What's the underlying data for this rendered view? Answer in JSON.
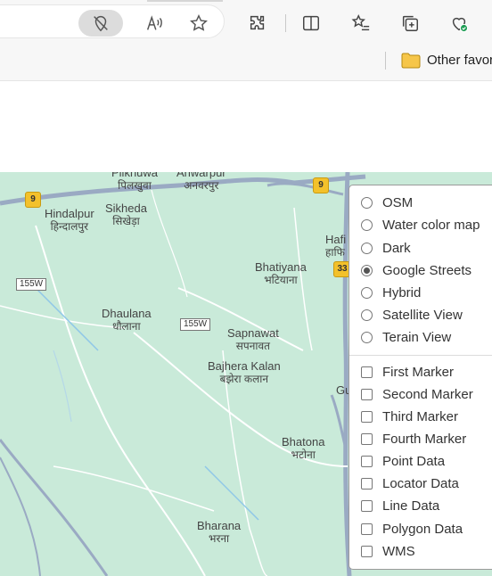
{
  "favorites": {
    "other_label": "Other favor"
  },
  "map": {
    "places": [
      {
        "name": "Pilkhuwa",
        "hindi": "पिलखुवा"
      },
      {
        "name": "Anwarpur",
        "hindi": "अनवरपुर"
      },
      {
        "name": "Hindalpur",
        "hindi": "हिन्दालपुर"
      },
      {
        "name": "Sikheda",
        "hindi": "सिखेड़ा"
      },
      {
        "name": "Hafi",
        "hindi": "हाफि"
      },
      {
        "name": "Bhatiyana",
        "hindi": "भटियाना"
      },
      {
        "name": "Dhaulana",
        "hindi": "धौलाना"
      },
      {
        "name": "Sapnawat",
        "hindi": "सपनावत"
      },
      {
        "name": "Bajhera Kalan",
        "hindi": "बझेरा कलान"
      },
      {
        "name": "Gu",
        "hindi": ""
      },
      {
        "name": "Bhatona",
        "hindi": "भटोना"
      },
      {
        "name": "Bharana",
        "hindi": "भरना"
      }
    ],
    "shields": [
      "9",
      "9",
      "33"
    ],
    "road_labels": [
      "155W",
      "155W"
    ]
  },
  "layer_control": {
    "base_layers": [
      {
        "label": "OSM",
        "selected": false
      },
      {
        "label": "Water color map",
        "selected": false
      },
      {
        "label": "Dark",
        "selected": false
      },
      {
        "label": "Google Streets",
        "selected": true
      },
      {
        "label": "Hybrid",
        "selected": false
      },
      {
        "label": "Satellite View",
        "selected": false
      },
      {
        "label": "Terain View",
        "selected": false
      }
    ],
    "overlays": [
      {
        "label": "First Marker",
        "checked": false
      },
      {
        "label": "Second Marker",
        "checked": false
      },
      {
        "label": "Third Marker",
        "checked": false
      },
      {
        "label": "Fourth Marker",
        "checked": false
      },
      {
        "label": "Point Data",
        "checked": false
      },
      {
        "label": "Locator Data",
        "checked": false
      },
      {
        "label": "Line Data",
        "checked": false
      },
      {
        "label": "Polygon Data",
        "checked": false
      },
      {
        "label": "WMS",
        "checked": false
      }
    ]
  }
}
